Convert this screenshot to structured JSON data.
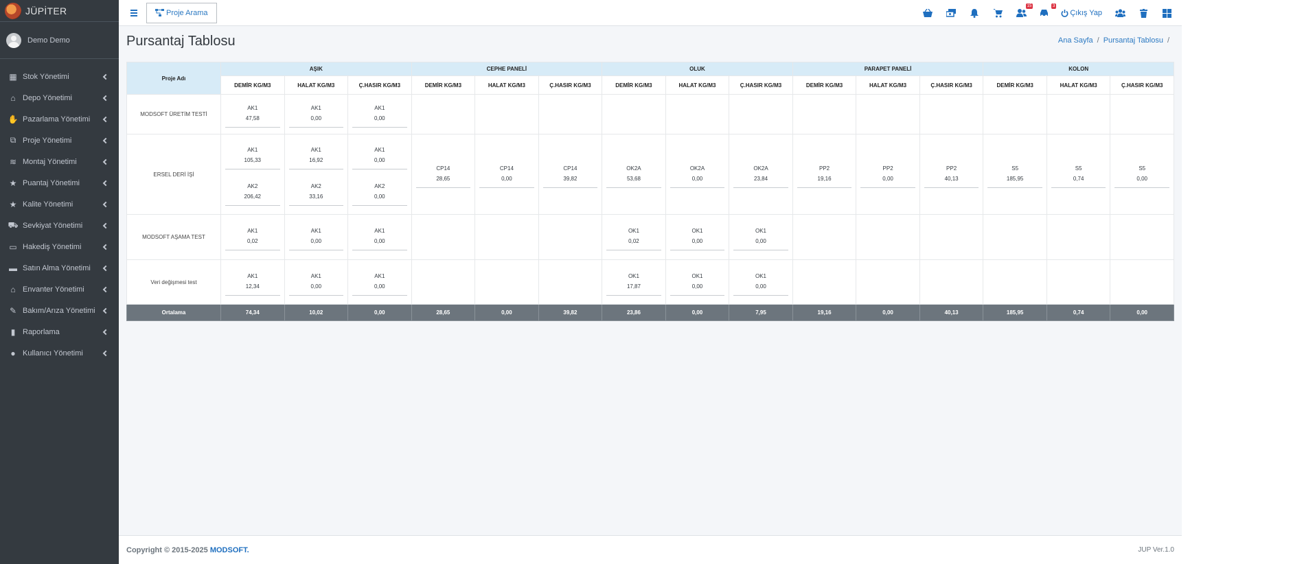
{
  "brand": {
    "name": "JÜPİTER"
  },
  "user": {
    "name": "Demo Demo"
  },
  "sidebar": {
    "items": [
      {
        "label": "Stok Yönetimi",
        "icon": "boxes-icon"
      },
      {
        "label": "Depo Yönetimi",
        "icon": "warehouse-icon"
      },
      {
        "label": "Pazarlama Yönetimi",
        "icon": "handshake-icon"
      },
      {
        "label": "Proje Yönetimi",
        "icon": "project-diagram-icon"
      },
      {
        "label": "Montaj Yönetimi",
        "icon": "layers-icon"
      },
      {
        "label": "Puantaj Yönetimi",
        "icon": "star-icon"
      },
      {
        "label": "Kalite Yönetimi",
        "icon": "star-icon"
      },
      {
        "label": "Sevkiyat Yönetimi",
        "icon": "truck-icon"
      },
      {
        "label": "Hakediş Yönetimi",
        "icon": "credit-card-icon"
      },
      {
        "label": "Satın Alma Yönetimi",
        "icon": "wallet-icon"
      },
      {
        "label": "Envanter Yönetimi",
        "icon": "warehouse-icon"
      },
      {
        "label": "Bakım/Arıza Yönetimi",
        "icon": "wrench-icon"
      },
      {
        "label": "Raporlama",
        "icon": "book-icon"
      },
      {
        "label": "Kullanıcı Yönetimi",
        "icon": "user-icon"
      }
    ]
  },
  "topbar": {
    "project_search": "Proje Arama",
    "badges": {
      "users": "15",
      "cars": "3"
    },
    "logout": "Çıkış Yap"
  },
  "page": {
    "title": "Pursantaj Tablosu",
    "breadcrumb": [
      "Ana Sayfa",
      "Pursantaj Tablosu"
    ]
  },
  "table": {
    "name_header": "Proje Adı",
    "groups": [
      "AŞIK",
      "CEPHE PANELİ",
      "OLUK",
      "PARAPET PANELİ",
      "KOLON"
    ],
    "subheaders": [
      "DEMİR KG/M3",
      "HALAT KG/M3",
      "Ç.HASIR KG/M3"
    ],
    "rows": [
      {
        "name": "MODSOFT ÜRETİM TESTİ",
        "cells": [
          [
            [
              "AK1",
              "47,58"
            ]
          ],
          [
            [
              "AK1",
              "0,00"
            ]
          ],
          [
            [
              "AK1",
              "0,00"
            ]
          ],
          [],
          [],
          [],
          [],
          [],
          [],
          [],
          [],
          [],
          [],
          [],
          []
        ]
      },
      {
        "name": "ERSEL DERİ İŞİ",
        "cells": [
          [
            [
              "AK1",
              "105,33"
            ],
            [
              "AK2",
              "206,42"
            ]
          ],
          [
            [
              "AK1",
              "16,92"
            ],
            [
              "AK2",
              "33,16"
            ]
          ],
          [
            [
              "AK1",
              "0,00"
            ],
            [
              "AK2",
              "0,00"
            ]
          ],
          [
            [
              "CP14",
              "28,65"
            ]
          ],
          [
            [
              "CP14",
              "0,00"
            ]
          ],
          [
            [
              "CP14",
              "39,82"
            ]
          ],
          [
            [
              "OK2A",
              "53,68"
            ]
          ],
          [
            [
              "OK2A",
              "0,00"
            ]
          ],
          [
            [
              "OK2A",
              "23,84"
            ]
          ],
          [
            [
              "PP2",
              "19,16"
            ]
          ],
          [
            [
              "PP2",
              "0,00"
            ]
          ],
          [
            [
              "PP2",
              "40,13"
            ]
          ],
          [
            [
              "S5",
              "185,95"
            ]
          ],
          [
            [
              "S5",
              "0,74"
            ]
          ],
          [
            [
              "S5",
              "0,00"
            ]
          ]
        ]
      },
      {
        "name": "MODSOFT AŞAMA TEST",
        "cells": [
          [
            [
              "AK1",
              "0,02"
            ]
          ],
          [
            [
              "AK1",
              "0,00"
            ]
          ],
          [
            [
              "AK1",
              "0,00"
            ]
          ],
          [],
          [],
          [],
          [
            [
              "OK1",
              "0,02"
            ]
          ],
          [
            [
              "OK1",
              "0,00"
            ]
          ],
          [
            [
              "OK1",
              "0,00"
            ]
          ],
          [],
          [],
          [],
          [],
          [],
          []
        ]
      },
      {
        "name": "Veri değişmesi test",
        "cells": [
          [
            [
              "AK1",
              "12,34"
            ]
          ],
          [
            [
              "AK1",
              "0,00"
            ]
          ],
          [
            [
              "AK1",
              "0,00"
            ]
          ],
          [],
          [],
          [],
          [
            [
              "OK1",
              "17,87"
            ]
          ],
          [
            [
              "OK1",
              "0,00"
            ]
          ],
          [
            [
              "OK1",
              "0,00"
            ]
          ],
          [],
          [],
          [],
          [],
          [],
          []
        ]
      }
    ],
    "average": {
      "label": "Ortalama",
      "values": [
        "74,34",
        "10,02",
        "0,00",
        "28,65",
        "0,00",
        "39,82",
        "23,86",
        "0,00",
        "7,95",
        "19,16",
        "0,00",
        "40,13",
        "185,95",
        "0,74",
        "0,00"
      ]
    }
  },
  "footer": {
    "copyright": "Copyright © 2015-2025",
    "brand": "MODSOFT.",
    "version": "JUP Ver.1.0"
  },
  "colors": {
    "sidebar_bg": "#343a40",
    "header_bg": "#d7ebf7",
    "link": "#2b79c2",
    "footer_row_bg": "#6c757d",
    "badge": "#dc3545"
  }
}
